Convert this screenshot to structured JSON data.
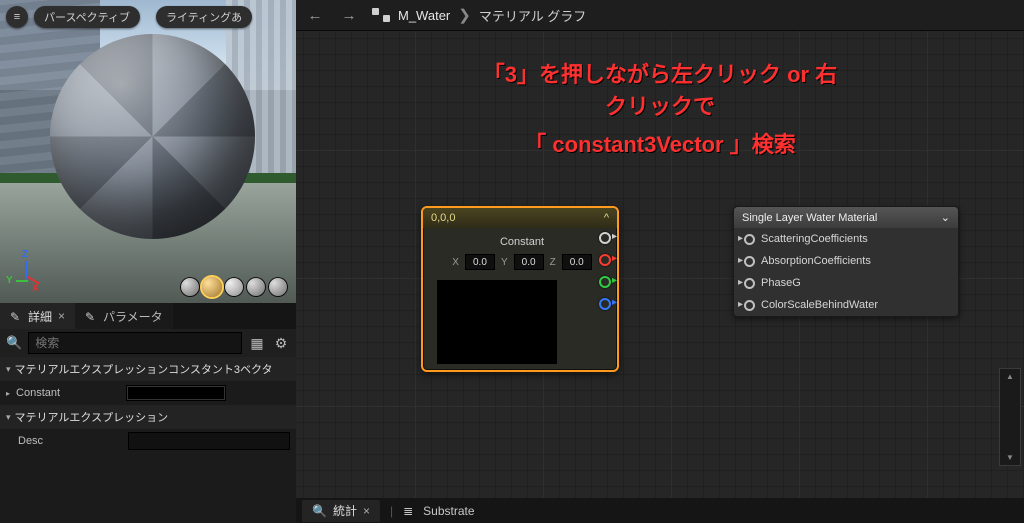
{
  "preview": {
    "menu_button": "≡",
    "pill_perspective": "パースペクティブ",
    "pill_lighting": "ライティングあ"
  },
  "axis": {
    "x": "X",
    "y": "Y",
    "z": "Z"
  },
  "tabs": {
    "details": {
      "label": "詳細"
    },
    "params": {
      "label": "パラメータ"
    }
  },
  "search": {
    "placeholder": "検索"
  },
  "details": {
    "cat_const3": "マテリアルエクスプレッションコンスタント3ベクタ",
    "row_constant": "Constant",
    "cat_expr": "マテリアルエクスプレッション",
    "row_desc": "Desc"
  },
  "breadcrumb": {
    "asset": "M_Water",
    "sep": "❯",
    "page": "マテリアル グラフ"
  },
  "instructions": {
    "line1": "「3」を押しながら左クリック or 右クリックで",
    "line2": "「 constant3Vector 」検索"
  },
  "node_const": {
    "title": "0,0,0",
    "collapse_caret": "^",
    "label": "Constant",
    "x_label": "X",
    "x_val": "0.0",
    "y_label": "Y",
    "y_val": "0.0",
    "z_label": "Z",
    "z_val": "0.0"
  },
  "node_out": {
    "title": "Single Layer Water Material",
    "caret": "⌄",
    "pins": [
      "ScatteringCoefficients",
      "AbsorptionCoefficients",
      "PhaseG",
      "ColorScaleBehindWater"
    ]
  },
  "status": {
    "stats": "統計",
    "substrate": "Substrate"
  },
  "glyphs": {
    "search": "🔍",
    "grid": "▦",
    "gear": "⚙",
    "chev_down": "▾",
    "chev_right": "▸",
    "close": "×",
    "back": "←",
    "fwd": "→",
    "list": "≣"
  }
}
